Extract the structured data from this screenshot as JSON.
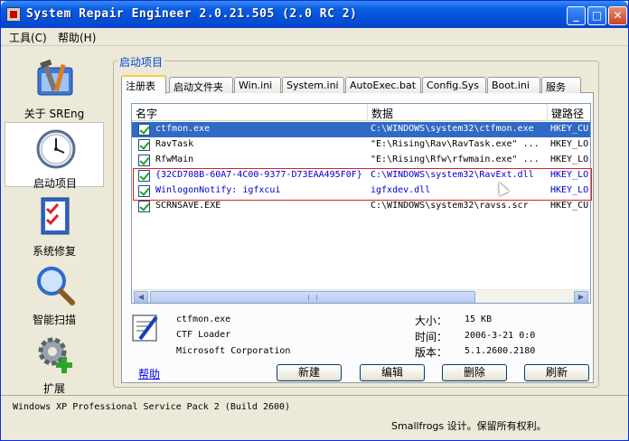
{
  "window": {
    "title": "System Repair Engineer 2.0.21.505 (2.0 RC 2)",
    "minimize": "_",
    "maximize": "□",
    "close": "✕"
  },
  "menu": {
    "tools": "工具(C)",
    "help": "帮助(H)"
  },
  "sidebar": {
    "items": [
      {
        "label": "关于 SREng",
        "icon": "toolbox-icon"
      },
      {
        "label": "启动项目",
        "icon": "clock-icon"
      },
      {
        "label": "系统修复",
        "icon": "checklist-icon"
      },
      {
        "label": "智能扫描",
        "icon": "magnifier-icon"
      },
      {
        "label": "扩展",
        "icon": "gear-plus-icon"
      }
    ]
  },
  "group_title": "启动项目",
  "tabs": [
    "注册表",
    "启动文件夹",
    "Win.ini",
    "System.ini",
    "AutoExec.bat",
    "Config.Sys",
    "Boot.ini",
    "服务"
  ],
  "list": {
    "columns": [
      "名字",
      "数据",
      "键路径"
    ],
    "rows": [
      {
        "name": "ctfmon.exe",
        "data": "C:\\WINDOWS\\system32\\ctfmon.exe",
        "key": "HKEY_CU"
      },
      {
        "name": "RavTask",
        "data": "\"E:\\Rising\\Rav\\RavTask.exe\" ...",
        "key": "HKEY_LO"
      },
      {
        "name": "RfwMain",
        "data": "\"E:\\Rising\\Rfw\\rfwmain.exe\" ...",
        "key": "HKEY_LO"
      },
      {
        "name": "{32CD708B-60A7-4C00-9377-D73EAA495F0F}",
        "data": "C:\\WINDOWS\\system32\\RavExt.dll",
        "key": "HKEY_LO"
      },
      {
        "name": "WinlogonNotify: igfxcui",
        "data": "igfxdev.dll",
        "key": "HKEY_LO"
      },
      {
        "name": "SCRNSAVE.EXE",
        "data": "C:\\WINDOWS\\system32\\ravss.scr",
        "key": "HKEY_CU"
      }
    ]
  },
  "details": {
    "name": "ctfmon.exe",
    "description": "CTF Loader",
    "company": "Microsoft Corporation",
    "size_label": "大小：",
    "size_value": "15 KB",
    "time_label": "时间：",
    "time_value": "2006-3-21 0:0",
    "version_label": "版本：",
    "version_value": "5.1.2600.2180"
  },
  "buttons": {
    "help": "帮助",
    "new": "新建",
    "edit": "编辑",
    "delete": "删除",
    "refresh": "刷新"
  },
  "status": {
    "os": "Windows XP Professional Service Pack 2 (Build 2600)",
    "copyright": "Smallfrogs 设计。保留所有权利。"
  },
  "colors": {
    "titlebar": "#0a5ce3",
    "selection": "#316ac5",
    "highlight_text": "#0000cc",
    "red_box": "#e02020"
  }
}
